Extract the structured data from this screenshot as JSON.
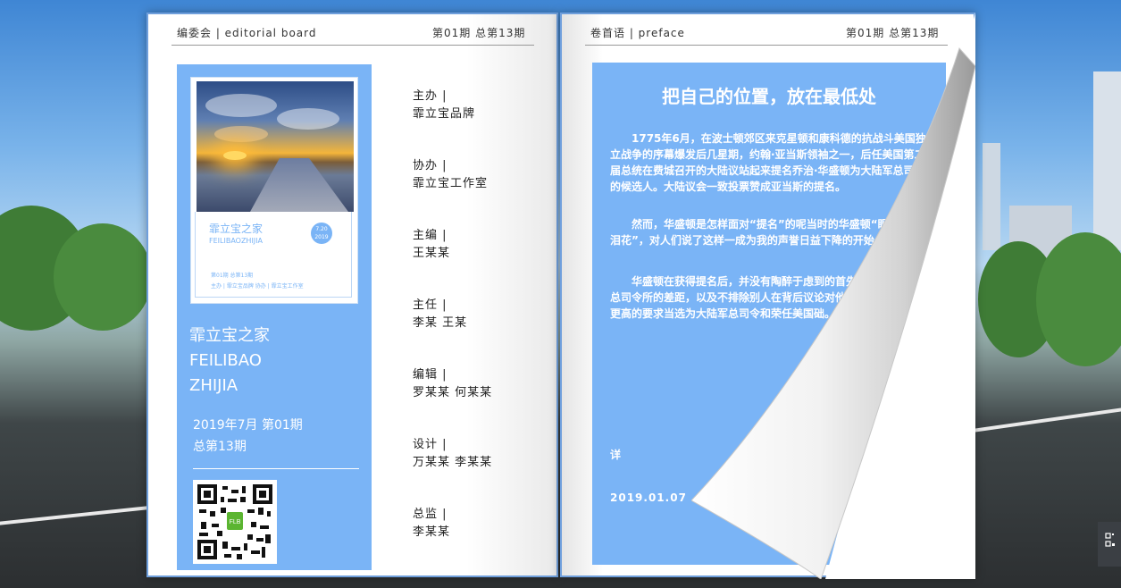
{
  "left_page": {
    "header_left": "编委会 | editorial board",
    "header_right": "第01期 总第13期",
    "cover_card": {
      "title": "霏立宝之家",
      "subtitle": "FEILIBAOZHIJIA",
      "date_badge_line1": "7.20",
      "date_badge_line2": "2019",
      "small_line1": "第01期 总第13期",
      "small_line2": "主办 | 霏立宝品牌      协办 | 霏立宝工作室"
    },
    "magazine_title_line1": "霏立宝之家",
    "magazine_title_line2": "FEILIBAO",
    "magazine_title_line3": "ZHIJIA",
    "issue_line1": "2019年7月 第01期",
    "issue_line2": "总第13期",
    "qr_center_label": "FLB",
    "staff": [
      {
        "role": "主办 |",
        "names": "霏立宝品牌"
      },
      {
        "role": "协办 |",
        "names": "霏立宝工作室"
      },
      {
        "role": "主编 |",
        "names": "王某某"
      },
      {
        "role": "主任 |",
        "names": "李某   王某"
      },
      {
        "role": "编辑 |",
        "names": "罗某某   何某某"
      },
      {
        "role": "设计 |",
        "names": "万某某   李某某"
      },
      {
        "role": "总监 |",
        "names": "李某某"
      }
    ]
  },
  "right_page": {
    "header_left": "卷首语 | preface",
    "header_right": "第01期 总第13期",
    "article_title": "把自己的位置，放在最低处",
    "paragraphs": [
      "1775年6月，在波士顿郊区来克星顿和康科德的抗战斗美国独立战争的序幕爆发后几星期，约翰·亚当斯领袖之一，后任美国第二届总统在费城召开的大陆议站起来提名乔治·华盛顿为大陆军总司令的候选人。大陆议会一致投票赞成亚当斯的提名。",
      "然而，华盛顿是怎样面对“提名”的呢当时的华盛顿“眼睛闪烁着泪花”，对人们说了这样一成为我的声誉日益下降的开始。”",
      "华盛顿在获得提名后，并没有陶醉于虑到的首先是自己与大陆军总司令所的差距，以及不排除别人在背后议论对他以后的工作提出了更高的要求当选为大陆军总司令和荣任美国础。"
    ],
    "more_label": "详",
    "date": "2019.01.07"
  },
  "colors": {
    "accent_blue": "#7ab4f6",
    "page_border": "#6f9fdc"
  },
  "icons": {
    "side_button": "qr-code-icon"
  }
}
